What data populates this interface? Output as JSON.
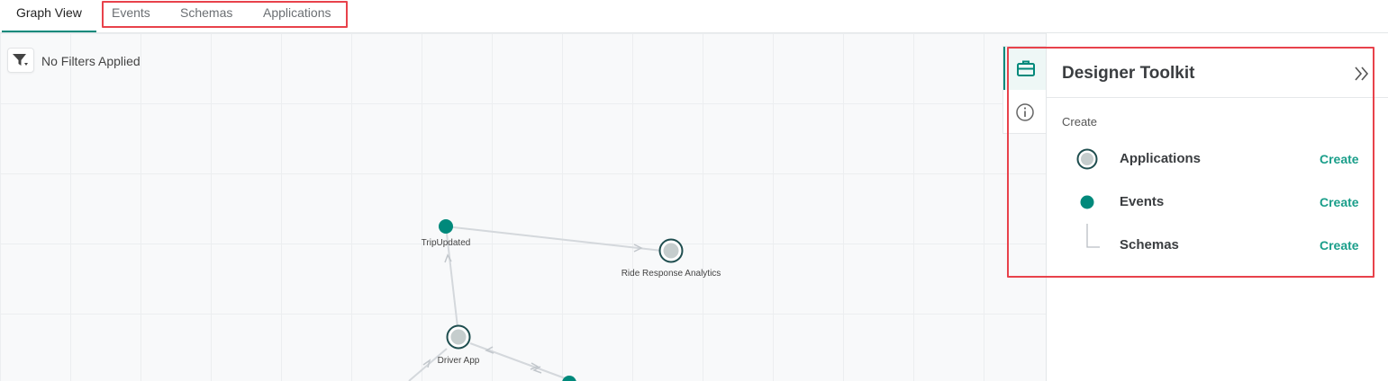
{
  "tabs": [
    {
      "label": "Graph View",
      "active": true
    },
    {
      "label": "Events"
    },
    {
      "label": "Schemas"
    },
    {
      "label": "Applications"
    }
  ],
  "filter": {
    "text": "No Filters Applied",
    "icon": "filter-icon"
  },
  "graph": {
    "nodes": [
      {
        "id": "trip-updated",
        "label": "TripUpdated",
        "kind": "event"
      },
      {
        "id": "ride-response-analytics",
        "label": "Ride Response Analytics",
        "kind": "application"
      },
      {
        "id": "driver-app",
        "label": "Driver App",
        "kind": "application"
      }
    ]
  },
  "toolkit": {
    "title": "Designer Toolkit",
    "section": "Create",
    "items": [
      {
        "label": "Applications",
        "action": "Create",
        "icon": "application-node-icon"
      },
      {
        "label": "Events",
        "action": "Create",
        "icon": "event-node-icon"
      },
      {
        "label": "Schemas",
        "action": "Create",
        "icon": "schema-connector-icon"
      }
    ]
  },
  "colors": {
    "accent": "#00897b",
    "highlight": "#e8424b",
    "eventNode": "#00897b",
    "appRing": "#1f4e4f"
  }
}
